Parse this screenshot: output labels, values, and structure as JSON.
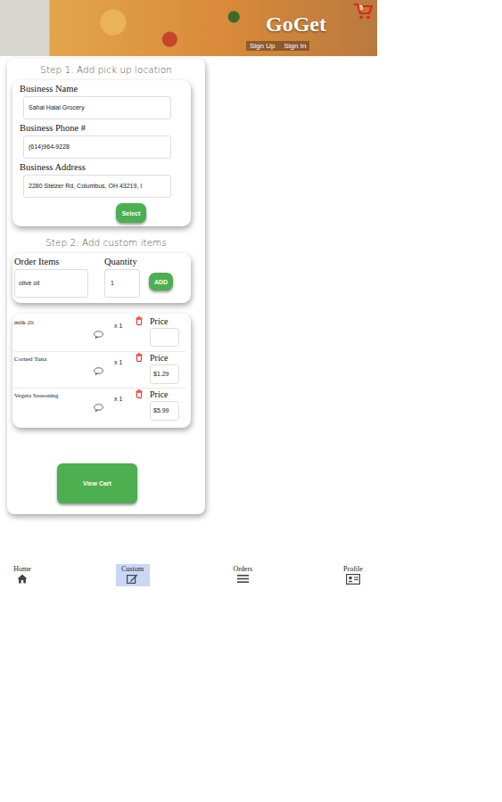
{
  "header": {
    "logo": "GoGet",
    "cart_count": "5",
    "links": [
      "Sign Up",
      "Sign In"
    ]
  },
  "step1": {
    "title": "Step 1: Add pick up location",
    "fields": [
      {
        "label": "Business Name",
        "value": "Sahal Halal Grocery"
      },
      {
        "label": "Business Phone #",
        "value": "(614)964-9228"
      },
      {
        "label": "Business Address",
        "value": "2280 Stelzer Rd, Columbus, OH 43219, I"
      }
    ],
    "button": "Select"
  },
  "step2": {
    "title": "Step 2: Add custom items",
    "item_label": "Order Items",
    "item_value": "olive oil",
    "quantity_label": "Quantity",
    "quantity_value": "1",
    "button": "ADD"
  },
  "cart_items": [
    {
      "name": "milk 2lt",
      "quantity": "x 1",
      "price_label": "Price",
      "price": ""
    },
    {
      "name": "Corned Tuna",
      "quantity": "x 1",
      "price_label": "Price",
      "price": "$1.29"
    },
    {
      "name": "Vegeta Seasoning",
      "quantity": "x 1",
      "price_label": "Price",
      "price": "$5.99"
    }
  ],
  "view_cart": "View Cart",
  "nav": [
    {
      "label": "Home",
      "selected": false
    },
    {
      "label": "Custom",
      "selected": true
    },
    {
      "label": "Orders",
      "selected": false
    },
    {
      "label": "Profile",
      "selected": false
    }
  ]
}
